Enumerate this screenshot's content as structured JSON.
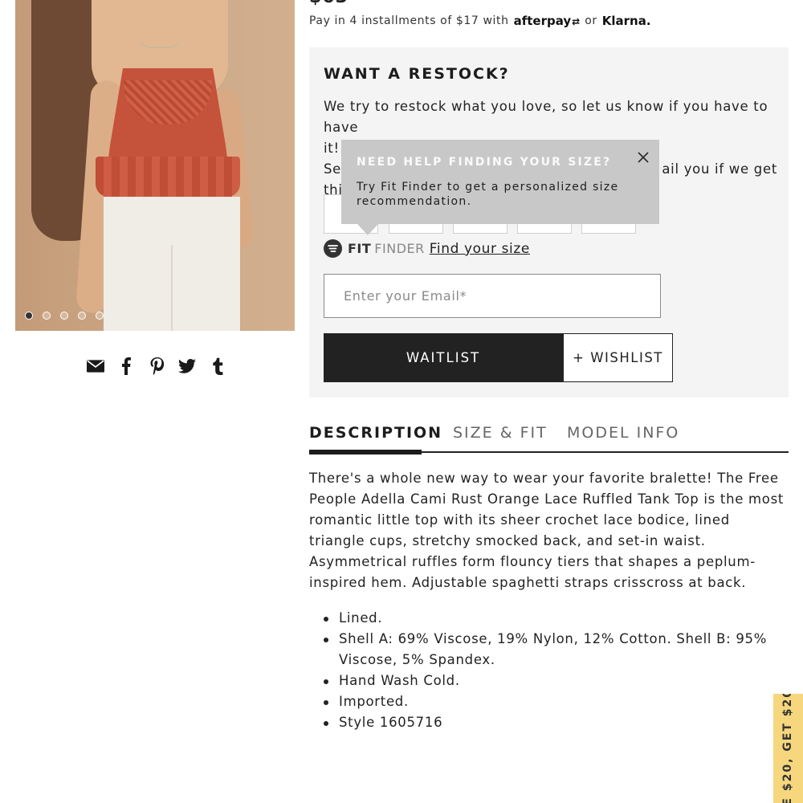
{
  "price": {
    "partial": "$63"
  },
  "installments": {
    "prefix": "Pay in 4 installments of $17 with",
    "afterpay": "afterpay",
    "or": "or",
    "klarna": "Klarna."
  },
  "product_image": {
    "alt": "Rust orange lace ruffled tank top",
    "slides": 5,
    "active_slide": 1
  },
  "social": [
    "email-icon",
    "facebook-icon",
    "pinterest-icon",
    "twitter-icon",
    "tumblr-icon"
  ],
  "restock": {
    "title": "WANT A RESTOCK?",
    "text": "We try to restock what you love, so let us know if you have to have it! Se                                               ail you if we get thi",
    "line1": "We try to restock what you love, so let us know if you have to have",
    "line2": "it!",
    "line3_left": "Se",
    "line3_right": "ail you if we get",
    "line4_left": "thi"
  },
  "tooltip": {
    "title": "NEED HELP FINDING YOUR SIZE?",
    "text": "Try Fit Finder to get a personalized size recommendation."
  },
  "fit_finder": {
    "bold": "FIT",
    "light": "FINDER",
    "link": "Find your size"
  },
  "email": {
    "placeholder": "Enter your Email*"
  },
  "buttons": {
    "waitlist": "WAITLIST",
    "wishlist": "+ WISHLIST"
  },
  "tabs": [
    {
      "label": "DESCRIPTION",
      "active": true
    },
    {
      "label": "SIZE & FIT",
      "active": false
    },
    {
      "label": "MODEL INFO",
      "active": false
    }
  ],
  "description": "There's a whole new way to wear your favorite bralette! The Free People Adella Cami Rust Orange Lace Ruffled Tank Top is the most romantic little top with its sheer crochet lace bodice, lined triangle cups, stretchy smocked back, and set-in waist. Asymmetrical ruffles form flouncy tiers that shapes a peplum-inspired hem. Adjustable spaghetti straps crisscross at back.",
  "details": [
    "Lined.",
    "Shell A: 69% Viscose, 19% Nylon, 12% Cotton. Shell B: 95% Viscose, 5% Spandex.",
    "Hand Wash Cold.",
    "Imported.",
    "Style 1605716"
  ],
  "promo": {
    "text": "E $20, GET $20"
  },
  "colors": {
    "promo_bg": "#f6d77e",
    "button_dark": "#222222",
    "panel_bg": "#f4f4f4",
    "tooltip_bg": "#c8c8c8"
  }
}
